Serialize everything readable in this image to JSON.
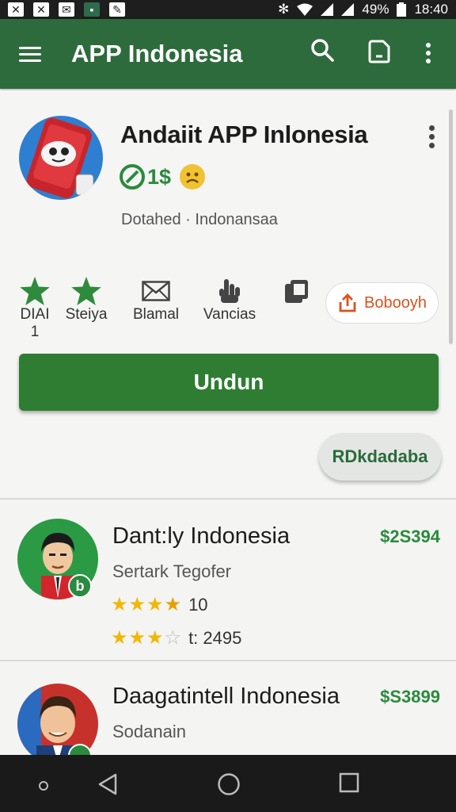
{
  "status_bar": {
    "battery": "49%",
    "time": "18:40"
  },
  "app_bar": {
    "title": "APP Indonesia"
  },
  "app": {
    "name": "Andaiit APP Inlonesia",
    "price": "1$",
    "meta": "Dotahed · Indonansaa",
    "stats": [
      {
        "label": "DIAI 1",
        "icon": "star-icon"
      },
      {
        "label": "Steiya",
        "icon": "star-icon"
      },
      {
        "label": "Blamal",
        "icon": "mail-icon"
      },
      {
        "label": "Vancias",
        "icon": "hand-icon"
      },
      {
        "label": "",
        "icon": "clipboard-icon"
      }
    ],
    "share_label": "Bobooyh",
    "install_label": "Undun",
    "chip_label": "RDkdadaba"
  },
  "list": [
    {
      "title": "Dant:ly Indonesia",
      "price": "$2S394",
      "sub": "Sertark  Tegofer",
      "rating_text": "10",
      "stars": 4.5,
      "stars2": 3,
      "rating2_text": "t: 2495"
    },
    {
      "title": "Daagatintell Indonesia",
      "price": "$S3899",
      "sub": "Sodanain"
    }
  ],
  "colors": {
    "primary": "#2e6b3c",
    "install": "#2e7d32",
    "price": "#2a8a3e",
    "star": "#f2b705",
    "share": "#d9531e"
  }
}
